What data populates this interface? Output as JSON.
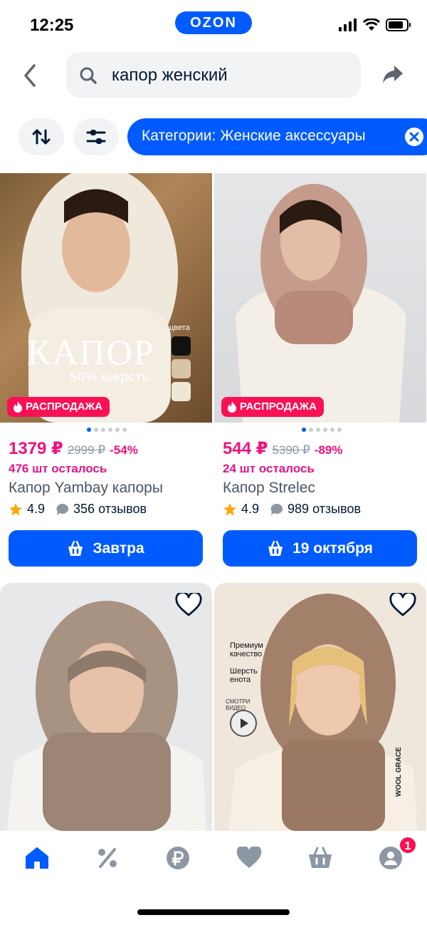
{
  "status_bar": {
    "time": "12:25",
    "logo": "OZON"
  },
  "search": {
    "query": "капор женский"
  },
  "filters": {
    "category_chip": "Категории: Женские аксессуары"
  },
  "products": [
    {
      "price": "1379 ₽",
      "old_price": "2999 ₽",
      "discount": "-54%",
      "stock": "476 шт осталось",
      "name": "Капор Yambay капоры",
      "rating": "4.9",
      "reviews": "356 отзывов",
      "sale_badge": "РАСПРОДАЖА",
      "delivery": "Завтра",
      "image": {
        "headline": "КАПОР",
        "subline": "50% шерсть",
        "colors_label": "цвета"
      }
    },
    {
      "price": "544 ₽",
      "old_price": "5390 ₽",
      "discount": "-89%",
      "stock": "24 шт осталось",
      "name": "Капор Strelec",
      "rating": "4.9",
      "reviews": "989 отзывов",
      "sale_badge": "РАСПРОДАЖА",
      "delivery": "19 октября"
    },
    {},
    {
      "image": {
        "badge1": "Премиум качество",
        "badge2": "Шерсть енота",
        "video": "СМОТРИ ВИДЕО",
        "brand": "WOOL GRACE"
      }
    }
  ],
  "bottom_nav": {
    "profile_badge": "1"
  },
  "colors": {
    "accent": "#005bff",
    "price": "#f1117e",
    "sale": "#f91155"
  },
  "icons": [
    "back-arrow-icon",
    "search-icon",
    "share-icon",
    "sort-icon",
    "filter-icon",
    "close-icon",
    "star-icon",
    "review-icon",
    "cart-icon",
    "heart-icon",
    "home-icon",
    "discount-icon",
    "ruble-icon",
    "favorites-icon",
    "basket-icon",
    "profile-icon"
  ]
}
